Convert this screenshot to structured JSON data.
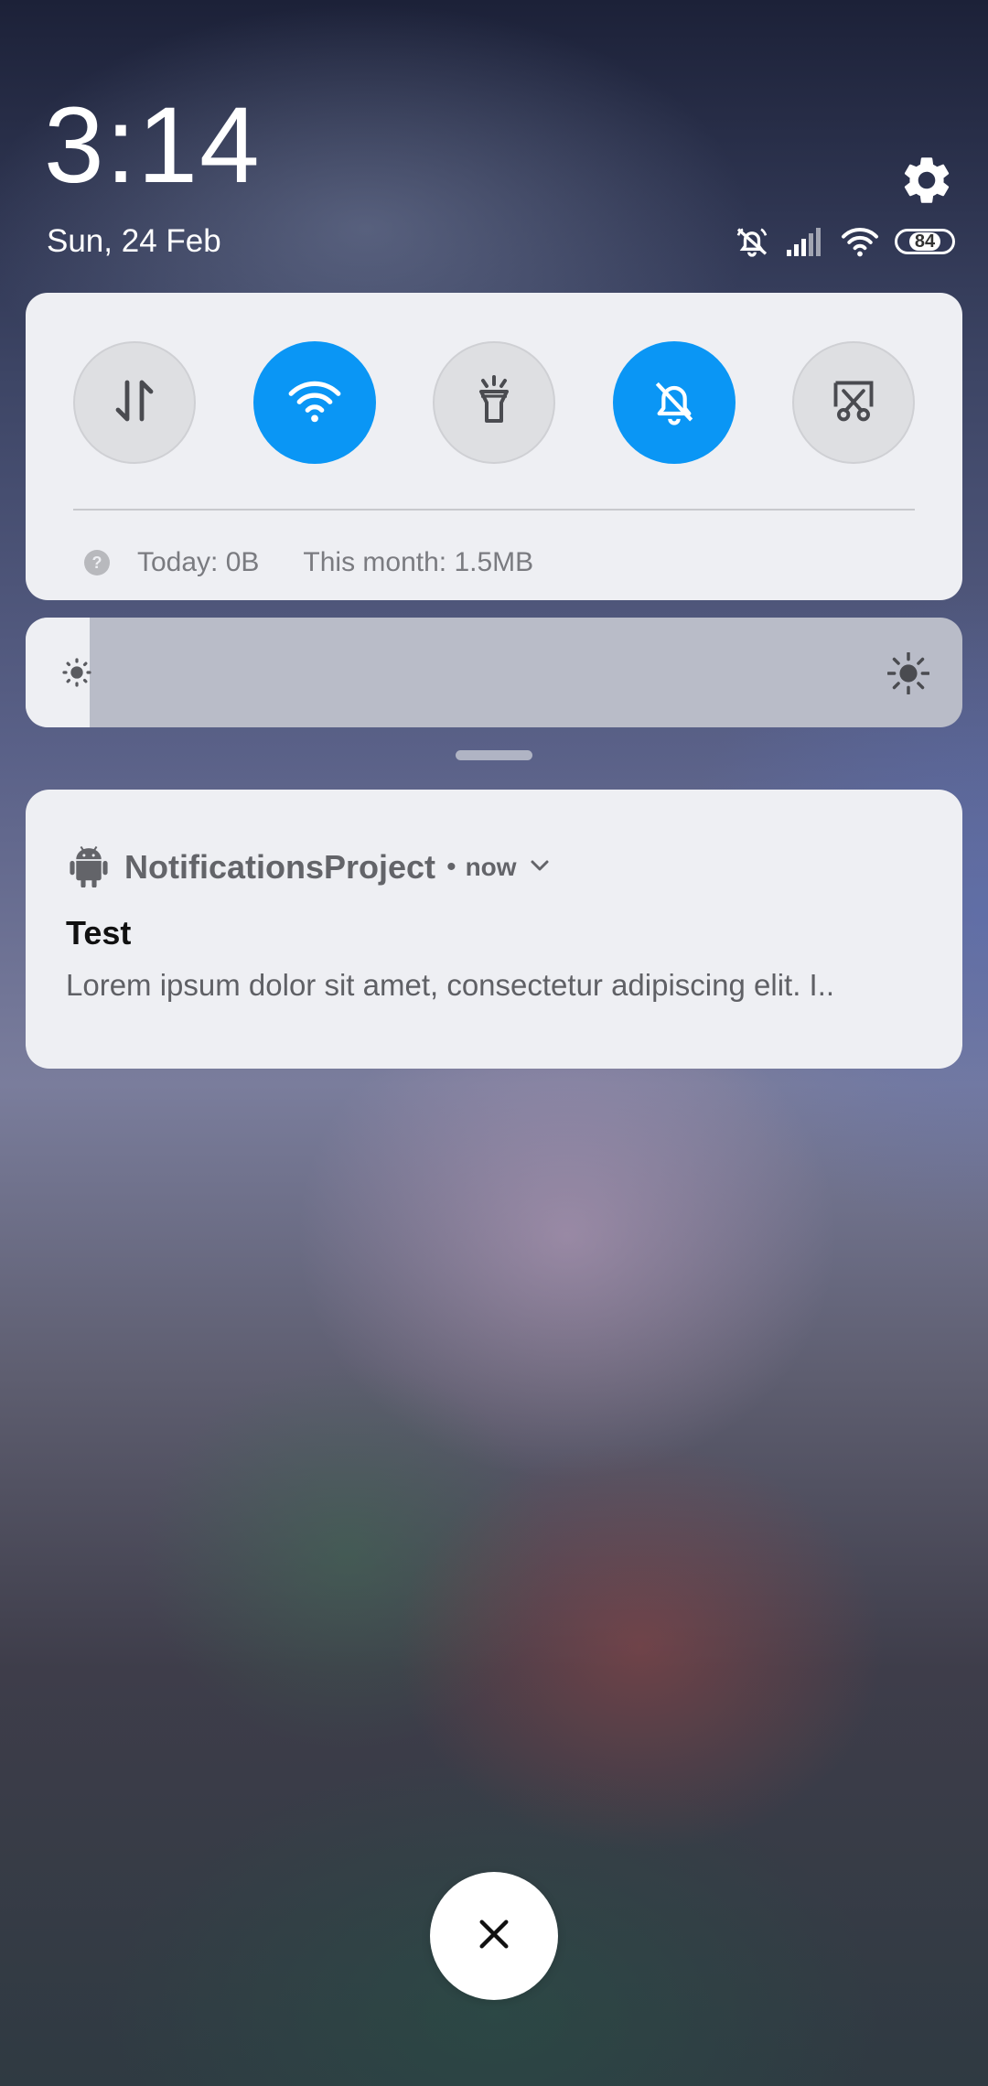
{
  "header": {
    "time": "3:14",
    "date": "Sun, 24 Feb",
    "battery_level": "84",
    "icons": [
      "settings-gear-icon",
      "ringer-off-icon",
      "cellular-signal-icon",
      "wifi-icon",
      "battery-icon"
    ]
  },
  "quick_settings": {
    "toggles": [
      {
        "name": "mobile-data",
        "icon": "data-transfer-icon",
        "state": "off"
      },
      {
        "name": "wifi",
        "icon": "wifi-icon",
        "state": "on"
      },
      {
        "name": "flashlight",
        "icon": "flashlight-icon",
        "state": "off"
      },
      {
        "name": "silent",
        "icon": "bell-off-icon",
        "state": "on"
      },
      {
        "name": "screenshot",
        "icon": "scissors-screenshot-icon",
        "state": "off"
      }
    ],
    "data_usage": {
      "today": "Today: 0B",
      "month": "This month: 1.5MB",
      "help_glyph": "?"
    },
    "accent_color": "#0A96F5"
  },
  "brightness": {
    "level_fraction": 0.068,
    "icons": [
      "brightness-low-icon",
      "brightness-high-icon"
    ]
  },
  "notification": {
    "app_name": "NotificationsProject",
    "separator": "•",
    "time": "now",
    "title": "Test",
    "body": "Lorem ipsum dolor sit amet, consectetur adipiscing elit. I..",
    "icons": [
      "android-robot-icon",
      "chevron-down-icon"
    ]
  },
  "close_button": {
    "icon": "close-icon"
  }
}
